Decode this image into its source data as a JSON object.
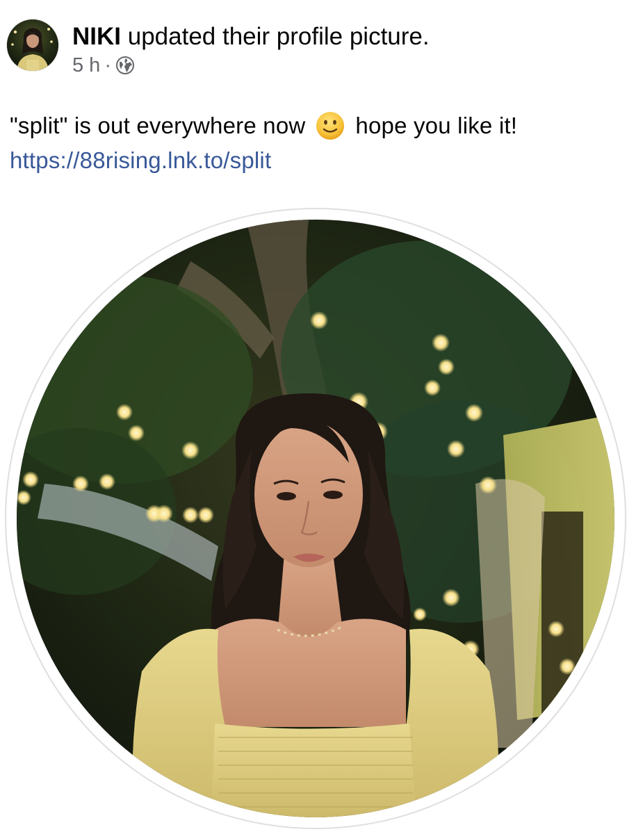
{
  "post": {
    "author": "NIKI",
    "action": "updated their profile picture.",
    "time": "5 h",
    "separator": "·",
    "audience_icon": "globe-icon",
    "caption": {
      "text_before_emoji": "\"split\" is out everywhere now",
      "emoji": "slightly-smiling-face-emoji",
      "text_after_emoji": "hope you like it!",
      "link": "https://88rising.lnk.to/split"
    },
    "image": {
      "subject": "profile-photo",
      "shape": "circle"
    }
  },
  "colors": {
    "text_primary": "#050505",
    "text_secondary": "#65676b",
    "link": "#385898",
    "background": "#ffffff",
    "photo_ring": "#dddfe2"
  }
}
